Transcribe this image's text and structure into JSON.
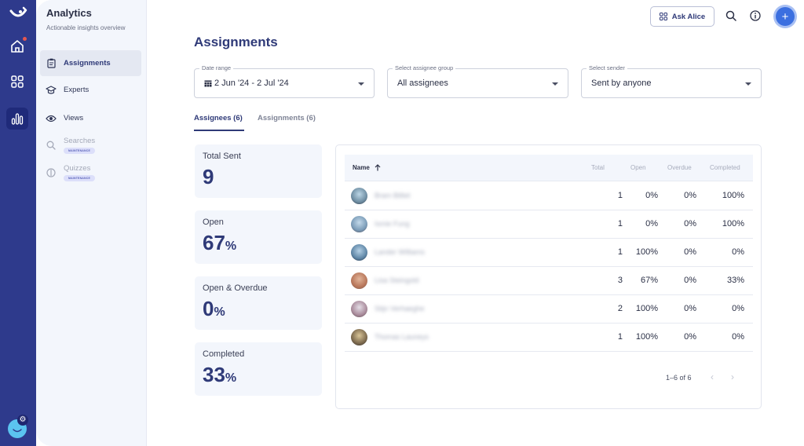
{
  "rail": {
    "items": [
      {
        "name": "home",
        "icon": "home-icon",
        "notification": true
      },
      {
        "name": "apps",
        "icon": "grid-icon"
      },
      {
        "name": "analytics",
        "icon": "bar-chart-icon",
        "active": true
      }
    ]
  },
  "sidebar": {
    "title": "Analytics",
    "subtitle": "Actionable insights overview",
    "items": [
      {
        "label": "Assignments",
        "icon": "clipboard-icon",
        "active": true
      },
      {
        "label": "Experts",
        "icon": "graduation-cap-icon"
      },
      {
        "label": "Views",
        "icon": "eye-icon"
      },
      {
        "label": "Searches",
        "icon": "search-icon",
        "badge": "MAINTENANCE",
        "disabled": true
      },
      {
        "label": "Quizzes",
        "icon": "quiz-icon",
        "badge": "MAINTENANCE",
        "disabled": true
      }
    ]
  },
  "topbar": {
    "ask_label": "Ask Alice"
  },
  "main": {
    "title": "Assignments",
    "filters": {
      "date_range": {
        "label": "Date range",
        "value": "2 Jun '24 - 2 Jul '24"
      },
      "assignee_group": {
        "label": "Select assignee group",
        "value": "All assignees"
      },
      "sender": {
        "label": "Select sender",
        "value": "Sent by anyone"
      }
    },
    "tabs": [
      {
        "label": "Assignees (6)",
        "active": true
      },
      {
        "label": "Assignments (6)",
        "active": false
      }
    ],
    "stats": [
      {
        "label": "Total Sent",
        "value": "9",
        "unit": ""
      },
      {
        "label": "Open",
        "value": "67",
        "unit": "%"
      },
      {
        "label": "Open & Overdue",
        "value": "0",
        "unit": "%"
      },
      {
        "label": "Completed",
        "value": "33",
        "unit": "%"
      }
    ],
    "table": {
      "columns": [
        "Name",
        "Total",
        "Open",
        "Overdue",
        "Completed"
      ],
      "rows": [
        {
          "name": "Bram Billiet",
          "total": "1",
          "open": "0%",
          "overdue": "0%",
          "completed": "100%"
        },
        {
          "name": "Ismie Fung",
          "total": "1",
          "open": "0%",
          "overdue": "0%",
          "completed": "100%"
        },
        {
          "name": "Lander Williams",
          "total": "1",
          "open": "100%",
          "overdue": "0%",
          "completed": "0%"
        },
        {
          "name": "Lisa Steingold",
          "total": "3",
          "open": "67%",
          "overdue": "0%",
          "completed": "33%"
        },
        {
          "name": "Stijn Verhaeghe",
          "total": "2",
          "open": "100%",
          "overdue": "0%",
          "completed": "0%"
        },
        {
          "name": "Thomas Launeys",
          "total": "1",
          "open": "100%",
          "overdue": "0%",
          "completed": "0%"
        }
      ],
      "pagination": "1–6 of 6"
    }
  },
  "colors": {
    "rail": "#2e3a8c",
    "accent": "#2f3a78",
    "primary_button": "#3b6fe0",
    "notification": "#e4574f"
  }
}
